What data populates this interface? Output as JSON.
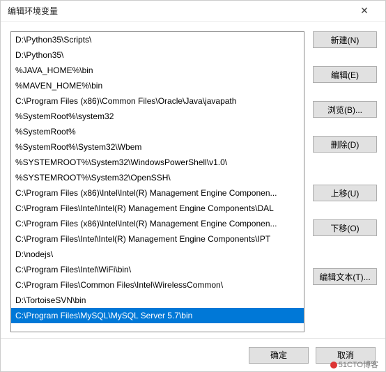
{
  "window": {
    "title": "编辑环境变量"
  },
  "list": {
    "items": [
      "D:\\Python35\\Scripts\\",
      "D:\\Python35\\",
      "%JAVA_HOME%\\bin",
      "%MAVEN_HOME%\\bin",
      "C:\\Program Files (x86)\\Common Files\\Oracle\\Java\\javapath",
      "%SystemRoot%\\system32",
      "%SystemRoot%",
      "%SystemRoot%\\System32\\Wbem",
      "%SYSTEMROOT%\\System32\\WindowsPowerShell\\v1.0\\",
      "%SYSTEMROOT%\\System32\\OpenSSH\\",
      "C:\\Program Files (x86)\\Intel\\Intel(R) Management Engine Componen...",
      "C:\\Program Files\\Intel\\Intel(R) Management Engine Components\\DAL",
      "C:\\Program Files (x86)\\Intel\\Intel(R) Management Engine Componen...",
      "C:\\Program Files\\Intel\\Intel(R) Management Engine Components\\IPT",
      "D:\\nodejs\\",
      "C:\\Program Files\\Intel\\WiFi\\bin\\",
      "C:\\Program Files\\Common Files\\Intel\\WirelessCommon\\",
      "D:\\TortoiseSVN\\bin",
      "C:\\Program Files\\MySQL\\MySQL Server 5.7\\bin"
    ],
    "selectedIndex": 18
  },
  "buttons": {
    "new": "新建(N)",
    "edit": "编辑(E)",
    "browse": "浏览(B)...",
    "delete": "删除(D)",
    "moveUp": "上移(U)",
    "moveDown": "下移(O)",
    "editText": "编辑文本(T)...",
    "ok": "确定",
    "cancel": "取消"
  },
  "watermark": "51CTO博客"
}
